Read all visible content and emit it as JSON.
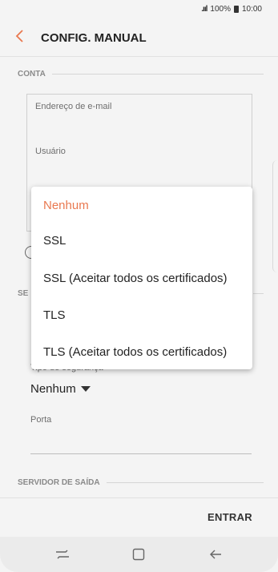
{
  "status_bar": {
    "signal": ".ııl",
    "battery_pct": "100%",
    "time": "10:00"
  },
  "header": {
    "title": "CONFIG. MANUAL"
  },
  "sections": {
    "conta": "CONTA",
    "server_fragment": "SE",
    "saida": "SERVIDOR DE SAÍDA"
  },
  "fields": {
    "email_label": "Endereço de e-mail",
    "user_label": "Usuário",
    "security_type_label": "Tipo de segurança",
    "security_type_value": "Nenhum",
    "port_label": "Porta"
  },
  "dropdown": {
    "options": [
      {
        "label": "Nenhum",
        "selected": true
      },
      {
        "label": "SSL",
        "selected": false
      },
      {
        "label": "SSL (Aceitar todos os certificados)",
        "selected": false
      },
      {
        "label": "TLS",
        "selected": false
      },
      {
        "label": "TLS (Aceitar todos os certificados)",
        "selected": false
      }
    ]
  },
  "footer": {
    "action_label": "ENTRAR"
  },
  "colors": {
    "accent": "#e9784f",
    "background": "#f4f4f4"
  },
  "icons": {
    "back": "chevron-left-icon",
    "recents": "recents-icon",
    "home": "home-icon",
    "nav_back": "back-arrow-icon"
  }
}
